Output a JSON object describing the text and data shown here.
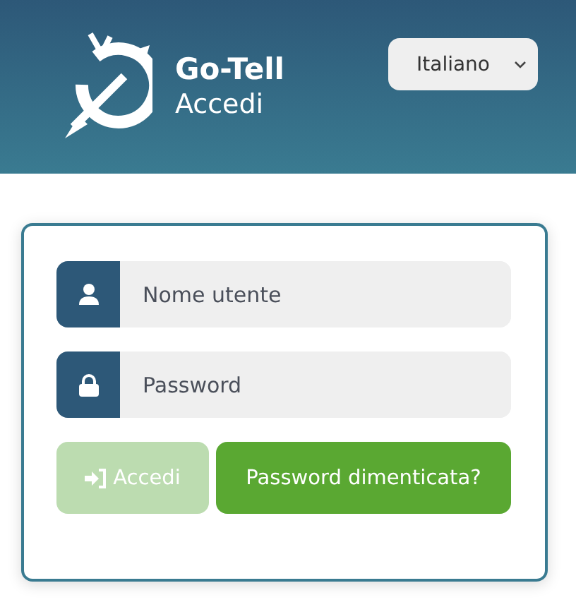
{
  "header": {
    "brand": "Go-Tell",
    "subtitle": "Accedi",
    "language": {
      "value": "Italiano"
    }
  },
  "form": {
    "fields": [
      {
        "kind": "user",
        "placeholder": "Nome utente"
      },
      {
        "kind": "lock",
        "placeholder": "Password"
      }
    ],
    "buttons": [
      {
        "kind": "login",
        "label": "Accedi",
        "disabled": true
      },
      {
        "kind": "plain",
        "label": "Password dimenticata?",
        "disabled": false
      }
    ]
  }
}
